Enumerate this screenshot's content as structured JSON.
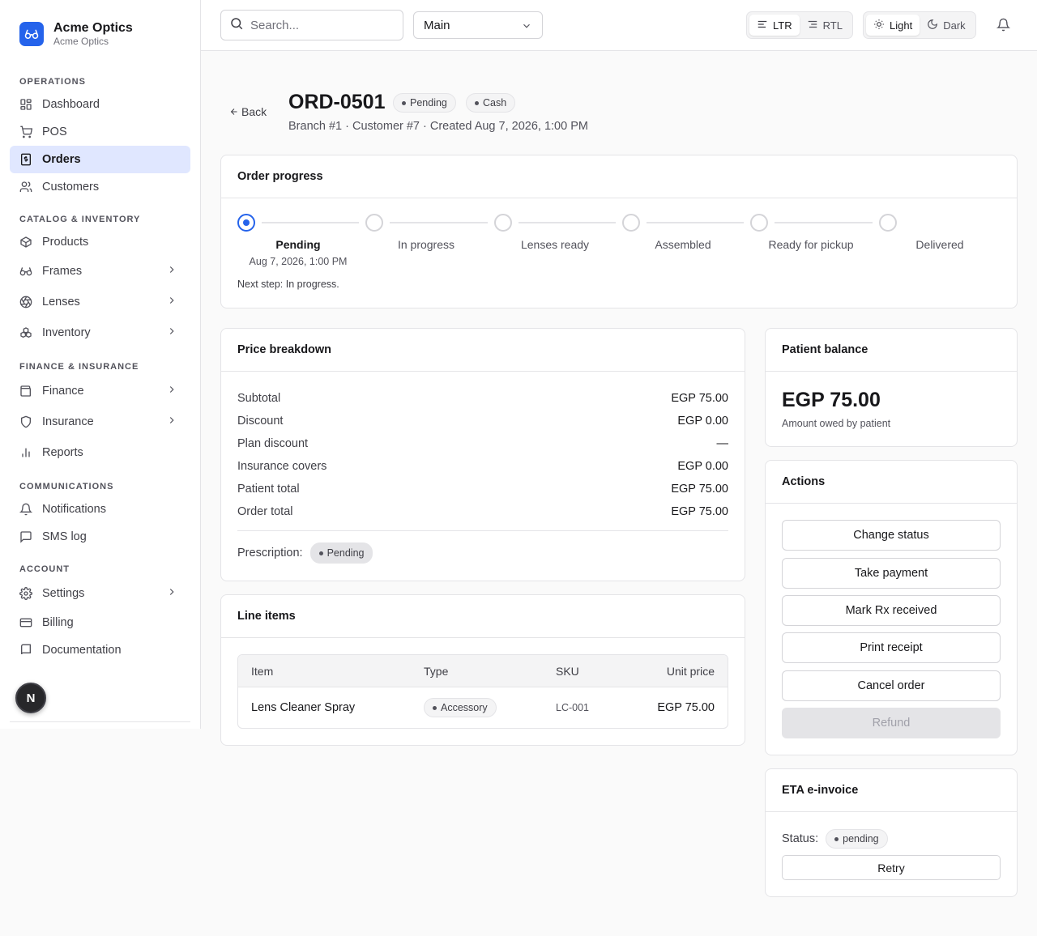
{
  "brand": {
    "name": "Acme Optics",
    "subtitle": "Acme Optics",
    "logo_icon": "glasses-icon",
    "color": "#2563eb"
  },
  "sidebar": {
    "sections": [
      {
        "heading": "OPERATIONS",
        "items": [
          {
            "label": "Dashboard",
            "icon": "dashboard-icon"
          },
          {
            "label": "POS",
            "icon": "cart-icon"
          },
          {
            "label": "Orders",
            "icon": "receipt-icon",
            "active": true
          },
          {
            "label": "Customers",
            "icon": "users-icon"
          }
        ]
      },
      {
        "heading": "CATALOG & INVENTORY",
        "items": [
          {
            "label": "Products",
            "icon": "box-icon"
          },
          {
            "label": "Frames",
            "icon": "glasses-icon",
            "expandable": true
          },
          {
            "label": "Lenses",
            "icon": "aperture-icon",
            "expandable": true
          },
          {
            "label": "Inventory",
            "icon": "boxes-icon",
            "expandable": true
          }
        ]
      },
      {
        "heading": "FINANCE & INSURANCE",
        "items": [
          {
            "label": "Finance",
            "icon": "wallet-icon",
            "expandable": true
          },
          {
            "label": "Insurance",
            "icon": "shield-icon",
            "expandable": true
          },
          {
            "label": "Reports",
            "icon": "bar-chart-icon"
          }
        ]
      },
      {
        "heading": "COMMUNICATIONS",
        "items": [
          {
            "label": "Notifications",
            "icon": "bell-icon"
          },
          {
            "label": "SMS log",
            "icon": "message-icon"
          }
        ]
      },
      {
        "heading": "ACCOUNT",
        "items": [
          {
            "label": "Settings",
            "icon": "gear-icon",
            "expandable": true
          },
          {
            "label": "Billing",
            "icon": "credit-card-icon"
          },
          {
            "label": "Documentation",
            "icon": "book-icon"
          }
        ]
      }
    ],
    "avatar_letter": "N"
  },
  "topbar": {
    "search_placeholder": "Search...",
    "branch": "Main",
    "direction": {
      "ltr": "LTR",
      "rtl": "RTL",
      "selected": "LTR"
    },
    "theme": {
      "light": "Light",
      "dark": "Dark",
      "selected": "Light"
    }
  },
  "order": {
    "back_label": "Back",
    "id": "ORD-0501",
    "status": "Pending",
    "payment": "Cash",
    "meta": "Branch #1 · Customer #7 · Created Aug 7, 2026, 1:00 PM"
  },
  "progress": {
    "title": "Order progress",
    "steps": [
      {
        "label": "Pending",
        "date": "Aug 7, 2026, 1:00 PM",
        "current": true
      },
      {
        "label": "In progress"
      },
      {
        "label": "Lenses ready"
      },
      {
        "label": "Assembled"
      },
      {
        "label": "Ready for pickup"
      },
      {
        "label": "Delivered"
      }
    ],
    "next_step": "Next step: In progress.",
    "accent": "#2563eb"
  },
  "price": {
    "title": "Price breakdown",
    "rows": [
      {
        "label": "Subtotal",
        "value": "EGP 75.00"
      },
      {
        "label": "Discount",
        "value": "EGP 0.00"
      },
      {
        "label": "Plan discount",
        "value": "—"
      },
      {
        "label": "Insurance covers",
        "value": "EGP 0.00"
      },
      {
        "label": "Patient total",
        "value": "EGP 75.00"
      },
      {
        "label": "Order total",
        "value": "EGP 75.00"
      }
    ],
    "prescription_label": "Prescription:",
    "prescription_status": "Pending"
  },
  "line_items": {
    "title": "Line items",
    "columns": [
      "Item",
      "Type",
      "SKU",
      "Unit price"
    ],
    "rows": [
      {
        "item": "Lens Cleaner Spray",
        "type": "Accessory",
        "sku": "LC-001",
        "unit_price": "EGP 75.00"
      }
    ]
  },
  "balance": {
    "title": "Patient balance",
    "amount": "EGP 75.00",
    "caption": "Amount owed by patient"
  },
  "actions": {
    "title": "Actions",
    "buttons": [
      {
        "label": "Change status"
      },
      {
        "label": "Take payment"
      },
      {
        "label": "Mark Rx received"
      },
      {
        "label": "Print receipt"
      },
      {
        "label": "Cancel order"
      },
      {
        "label": "Refund",
        "disabled": true
      }
    ]
  },
  "einvoice": {
    "title": "ETA e-invoice",
    "status_label": "Status:",
    "status": "pending",
    "retry_label": "Retry"
  }
}
